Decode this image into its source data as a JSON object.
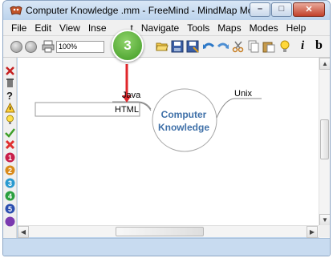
{
  "window": {
    "title": "Computer Knowledge .mm - FreeMind - MindMap Mode",
    "minimize_glyph": "–",
    "maximize_glyph": "□",
    "close_glyph": "✕"
  },
  "menubar": {
    "items": [
      "File",
      "Edit",
      "View",
      "Inse",
      "t",
      "Navigate",
      "Tools",
      "Maps",
      "Modes",
      "Help"
    ]
  },
  "toolbar": {
    "zoom_value": "100%",
    "italic_label": "i",
    "bold_label": "b"
  },
  "mindmap": {
    "central_node_line1": "Computer",
    "central_node_line2": "Knowledge",
    "child_nodes": [
      "Java",
      "HTML",
      "Unix"
    ],
    "accent_color": "#3f70a8"
  },
  "callout": {
    "step_number": "3",
    "color": "#4aa52a",
    "arrow_color": "#e0262b"
  },
  "left_toolbar": {
    "icons": [
      "cross-icon",
      "trash-icon",
      "question-icon",
      "warning-icon",
      "lightbulb-icon",
      "checkmark-icon",
      "red-cross-icon",
      "priority-1-icon",
      "priority-2-icon",
      "priority-3-icon",
      "priority-4-icon",
      "priority-5-icon"
    ]
  }
}
